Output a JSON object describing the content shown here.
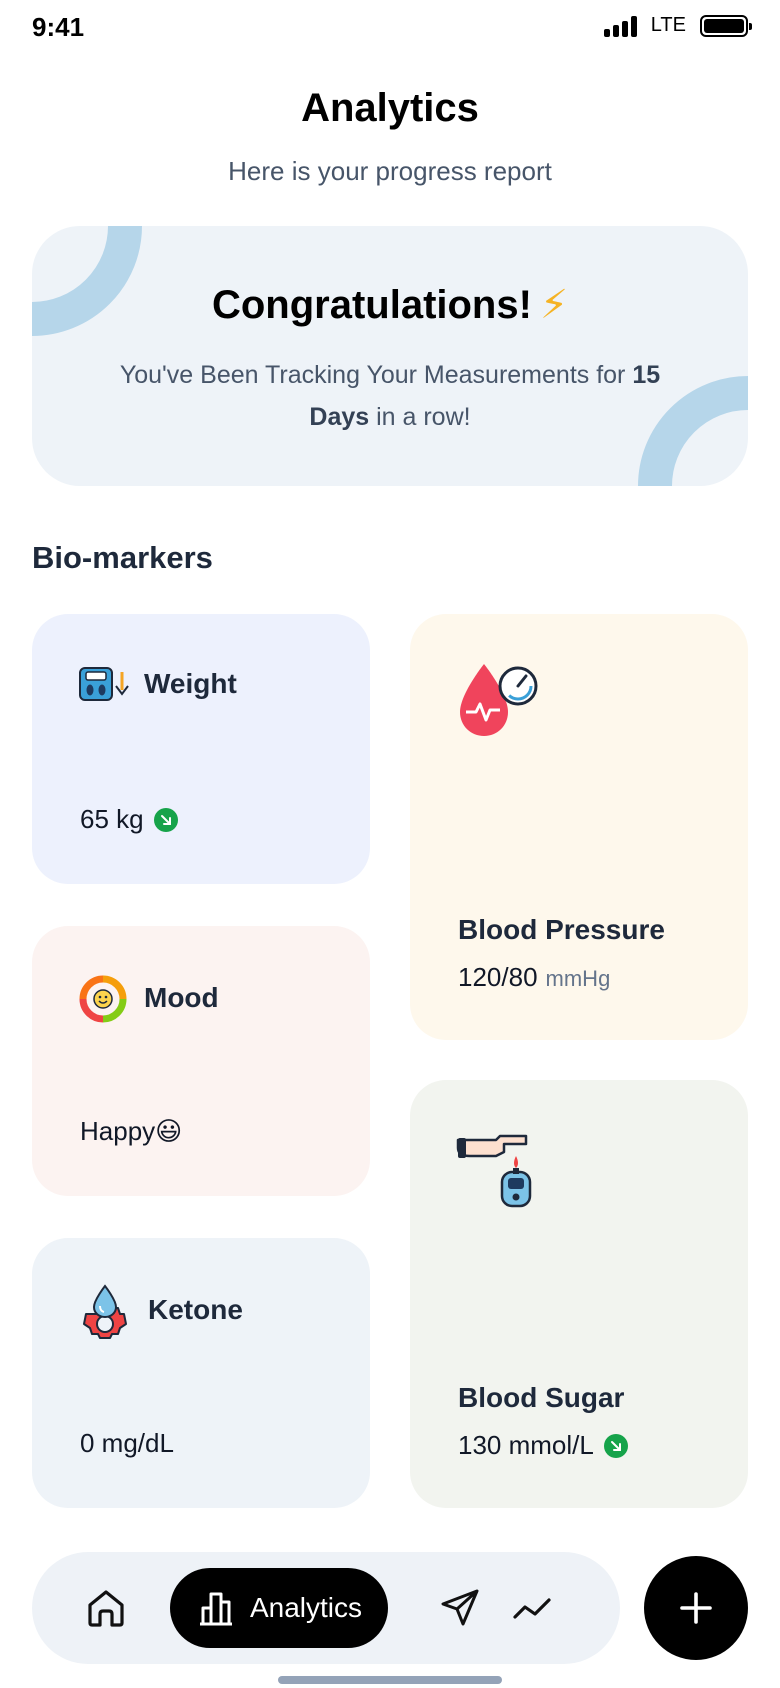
{
  "status_bar": {
    "time": "9:41",
    "network": "LTE"
  },
  "header": {
    "title": "Analytics",
    "subtitle": "Here is your progress report"
  },
  "congrats": {
    "title": "Congratulations!",
    "text_before": "You've Been Tracking Your Measurements for ",
    "streak": "15 Days",
    "text_after": " in a row!"
  },
  "section": {
    "title": "Bio-markers"
  },
  "cards": {
    "weight": {
      "title": "Weight",
      "value": "65 kg",
      "trend": "down",
      "icon": "scale-icon",
      "bg": "#edf1fd"
    },
    "blood_pressure": {
      "title": "Blood Pressure",
      "value": "120/80",
      "unit": "mmHg",
      "icon": "blood-pressure-icon",
      "bg": "#fef8ec"
    },
    "mood": {
      "title": "Mood",
      "value": "Happy😃",
      "icon": "mood-icon",
      "bg": "#fcf3f1"
    },
    "blood_sugar": {
      "title": "Blood Sugar",
      "value": "130 mmol/L",
      "trend": "down",
      "icon": "glucose-meter-icon",
      "bg": "#f2f4ef"
    },
    "ketone": {
      "title": "Ketone",
      "value": "0 mg/dL",
      "icon": "ketone-icon",
      "bg": "#eef3f8"
    }
  },
  "nav": {
    "items": [
      {
        "name": "home",
        "icon": "home-icon"
      },
      {
        "name": "analytics",
        "icon": "bar-chart-icon",
        "label": "Analytics",
        "active": true
      },
      {
        "name": "send",
        "icon": "send-icon"
      },
      {
        "name": "trends",
        "icon": "trend-line-icon"
      }
    ],
    "fab_icon": "plus-icon"
  },
  "colors": {
    "accent": "#000000",
    "trend_down": "#16a34a",
    "arc": "#b6d6ea"
  }
}
